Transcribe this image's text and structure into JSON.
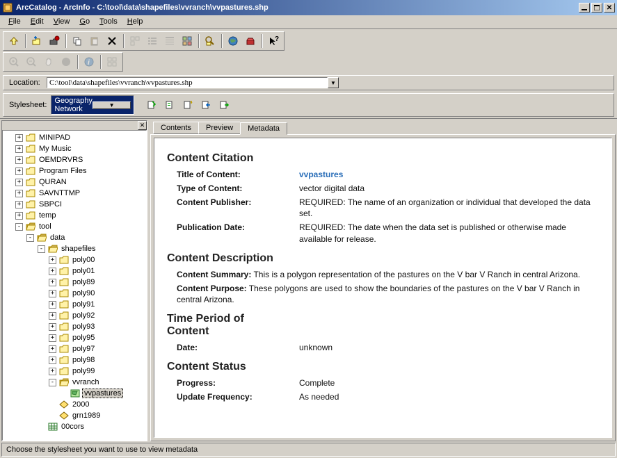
{
  "titlebar": {
    "text": "ArcCatalog - ArcInfo - C:\\tool\\data\\shapefiles\\vvranch\\vvpastures.shp"
  },
  "menu": {
    "file": "File",
    "edit": "Edit",
    "view": "View",
    "go": "Go",
    "tools": "Tools",
    "help": "Help"
  },
  "location": {
    "label": "Location:",
    "value": "C:\\tool\\data\\shapefiles\\vvranch\\vvpastures.shp"
  },
  "stylesheet": {
    "label": "Stylesheet:",
    "value": "Geography Network"
  },
  "tree": {
    "items": [
      {
        "level": 1,
        "toggle": "+",
        "icon": "folder",
        "label": "MINIPAD"
      },
      {
        "level": 1,
        "toggle": "+",
        "icon": "folder",
        "label": "My Music"
      },
      {
        "level": 1,
        "toggle": "+",
        "icon": "folder",
        "label": "OEMDRVRS"
      },
      {
        "level": 1,
        "toggle": "+",
        "icon": "folder",
        "label": "Program Files"
      },
      {
        "level": 1,
        "toggle": "+",
        "icon": "folder",
        "label": "QURAN"
      },
      {
        "level": 1,
        "toggle": "+",
        "icon": "folder",
        "label": "SAVNTTMP"
      },
      {
        "level": 1,
        "toggle": "+",
        "icon": "folder",
        "label": "SBPCI"
      },
      {
        "level": 1,
        "toggle": "+",
        "icon": "folder",
        "label": "temp"
      },
      {
        "level": 1,
        "toggle": "-",
        "icon": "folder-open",
        "label": "tool"
      },
      {
        "level": 2,
        "toggle": "-",
        "icon": "folder-open",
        "label": "data"
      },
      {
        "level": 3,
        "toggle": "-",
        "icon": "folder-open",
        "label": "shapefiles"
      },
      {
        "level": 4,
        "toggle": "+",
        "icon": "folder",
        "label": "poly00"
      },
      {
        "level": 4,
        "toggle": "+",
        "icon": "folder",
        "label": "poly01"
      },
      {
        "level": 4,
        "toggle": "+",
        "icon": "folder",
        "label": "poly89"
      },
      {
        "level": 4,
        "toggle": "+",
        "icon": "folder",
        "label": "poly90"
      },
      {
        "level": 4,
        "toggle": "+",
        "icon": "folder",
        "label": "poly91"
      },
      {
        "level": 4,
        "toggle": "+",
        "icon": "folder",
        "label": "poly92"
      },
      {
        "level": 4,
        "toggle": "+",
        "icon": "folder",
        "label": "poly93"
      },
      {
        "level": 4,
        "toggle": "+",
        "icon": "folder",
        "label": "poly95"
      },
      {
        "level": 4,
        "toggle": "+",
        "icon": "folder",
        "label": "poly97"
      },
      {
        "level": 4,
        "toggle": "+",
        "icon": "folder",
        "label": "poly98"
      },
      {
        "level": 4,
        "toggle": "+",
        "icon": "folder",
        "label": "poly99"
      },
      {
        "level": 4,
        "toggle": "-",
        "icon": "folder-open",
        "label": "vvranch"
      },
      {
        "level": 5,
        "toggle": "",
        "icon": "poly-shp",
        "label": "vvpastures",
        "selected": true
      },
      {
        "level": 4,
        "toggle": "",
        "icon": "poly-cov",
        "label": "2000"
      },
      {
        "level": 4,
        "toggle": "",
        "icon": "poly-cov",
        "label": "grn1989"
      },
      {
        "level": 3,
        "toggle": "",
        "icon": "grid",
        "label": "00cors"
      }
    ]
  },
  "tabs": {
    "contents": "Contents",
    "preview": "Preview",
    "metadata": "Metadata"
  },
  "metadata": {
    "citation_heading": "Content Citation",
    "title_label": "Title of Content:",
    "title_value": "vvpastures",
    "type_label": "Type of Content:",
    "type_value": "vector digital data",
    "publisher_label": "Content Publisher:",
    "publisher_value": "REQUIRED: The name of an organization or individual that developed the data set.",
    "pubdate_label": "Publication Date:",
    "pubdate_value": "REQUIRED: The date when the data set is published or otherwise made available for release.",
    "desc_heading": "Content Description",
    "summary_label": "Content Summary:",
    "summary_value": " This is a polygon representation of the pastures on the V bar V Ranch in central Arizona.",
    "purpose_label": "Content Purpose:",
    "purpose_value": " These polygons are used to show the boundaries of the pastures on the V bar V Ranch in central Arizona.",
    "time_heading": "Time Period of Content",
    "date_label": "Date:",
    "date_value": "unknown",
    "status_heading": "Content Status",
    "progress_label": "Progress:",
    "progress_value": "Complete",
    "update_label": "Update Frequency:",
    "update_value": "As needed"
  },
  "status": {
    "text": "Choose the stylesheet you want to use to view metadata"
  }
}
